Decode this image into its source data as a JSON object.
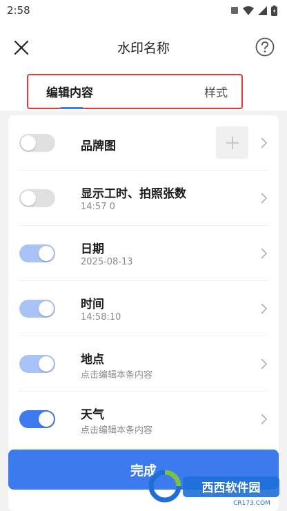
{
  "status_bar": {
    "time": "2:58"
  },
  "header": {
    "title": "水印名称"
  },
  "tabs": [
    {
      "label": "编辑内容",
      "active": true
    },
    {
      "label": "样式",
      "active": false
    }
  ],
  "items": [
    {
      "title": "品牌图",
      "subtitle": "",
      "toggle": "off"
    },
    {
      "title": "显示工时、拍照张数",
      "subtitle": "14:57  0",
      "toggle": "off"
    },
    {
      "title": "日期",
      "subtitle": "2025-08-13",
      "toggle": "on"
    },
    {
      "title": "时间",
      "subtitle": "14:58:10",
      "toggle": "on"
    },
    {
      "title": "地点",
      "subtitle": "点击编辑本条内容",
      "toggle": "on"
    },
    {
      "title": "天气",
      "subtitle": "点击编辑本条内容",
      "toggle": "on"
    }
  ],
  "done_button": {
    "label": "完成"
  },
  "watermark": {
    "name": "西西软件园",
    "site": "CR173.COM"
  },
  "colors": {
    "accent": "#3c7af0",
    "toggle_on_light": "#a9c3f7",
    "highlight_border": "#e53935"
  }
}
